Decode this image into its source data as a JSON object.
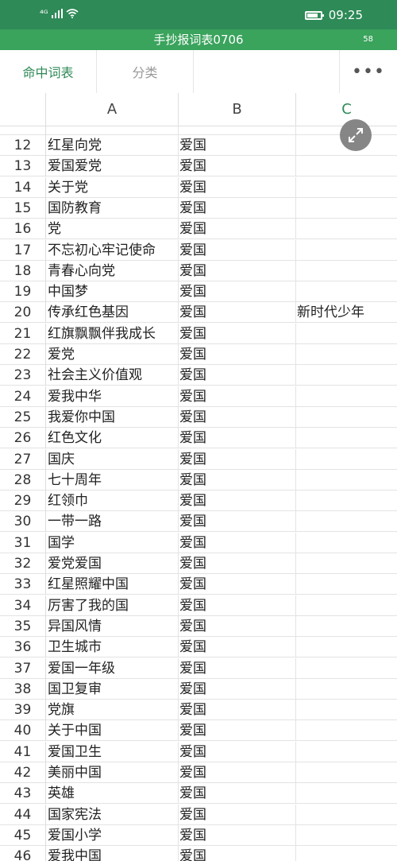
{
  "status": {
    "signal": "⁴ᴳ",
    "time": "09:25"
  },
  "title": {
    "text": "手抄报词表0706",
    "badge": "58"
  },
  "tabs": [
    {
      "label": "命中词表"
    },
    {
      "label": "分类"
    }
  ],
  "more_label": "•••",
  "columns": [
    "A",
    "B",
    "C"
  ],
  "rows": [
    {
      "n": "12",
      "a": "红星向党",
      "b": "爱国",
      "c": ""
    },
    {
      "n": "13",
      "a": "爱国爱党",
      "b": "爱国",
      "c": ""
    },
    {
      "n": "14",
      "a": "关于党",
      "b": "爱国",
      "c": ""
    },
    {
      "n": "15",
      "a": "国防教育",
      "b": "爱国",
      "c": ""
    },
    {
      "n": "16",
      "a": "党",
      "b": "爱国",
      "c": ""
    },
    {
      "n": "17",
      "a": "不忘初心牢记使命",
      "b": "爱国",
      "c": ""
    },
    {
      "n": "18",
      "a": "青春心向党",
      "b": "爱国",
      "c": ""
    },
    {
      "n": "19",
      "a": "中国梦",
      "b": "爱国",
      "c": ""
    },
    {
      "n": "20",
      "a": "传承红色基因",
      "b": "爱国",
      "c": "新时代少年"
    },
    {
      "n": "21",
      "a": "红旗飘飘伴我成长",
      "b": "爱国",
      "c": ""
    },
    {
      "n": "22",
      "a": "爱党",
      "b": "爱国",
      "c": ""
    },
    {
      "n": "23",
      "a": "社会主义价值观",
      "b": "爱国",
      "c": ""
    },
    {
      "n": "24",
      "a": "爱我中华",
      "b": "爱国",
      "c": ""
    },
    {
      "n": "25",
      "a": "我爱你中国",
      "b": "爱国",
      "c": ""
    },
    {
      "n": "26",
      "a": "红色文化",
      "b": "爱国",
      "c": ""
    },
    {
      "n": "27",
      "a": "国庆",
      "b": "爱国",
      "c": ""
    },
    {
      "n": "28",
      "a": "七十周年",
      "b": "爱国",
      "c": ""
    },
    {
      "n": "29",
      "a": "红领巾",
      "b": "爱国",
      "c": ""
    },
    {
      "n": "30",
      "a": "一带一路",
      "b": "爱国",
      "c": ""
    },
    {
      "n": "31",
      "a": "国学",
      "b": "爱国",
      "c": ""
    },
    {
      "n": "32",
      "a": "爱党爱国",
      "b": "爱国",
      "c": ""
    },
    {
      "n": "33",
      "a": "红星照耀中国",
      "b": "爱国",
      "c": ""
    },
    {
      "n": "34",
      "a": "厉害了我的国",
      "b": "爱国",
      "c": ""
    },
    {
      "n": "35",
      "a": "异国风情",
      "b": "爱国",
      "c": ""
    },
    {
      "n": "36",
      "a": "卫生城市",
      "b": "爱国",
      "c": ""
    },
    {
      "n": "37",
      "a": "爱国一年级",
      "b": "爱国",
      "c": ""
    },
    {
      "n": "38",
      "a": "国卫复审",
      "b": "爱国",
      "c": ""
    },
    {
      "n": "39",
      "a": "党旗",
      "b": "爱国",
      "c": ""
    },
    {
      "n": "40",
      "a": "关于中国",
      "b": "爱国",
      "c": ""
    },
    {
      "n": "41",
      "a": "爱国卫生",
      "b": "爱国",
      "c": ""
    },
    {
      "n": "42",
      "a": "美丽中国",
      "b": "爱国",
      "c": ""
    },
    {
      "n": "43",
      "a": "英雄",
      "b": "爱国",
      "c": ""
    },
    {
      "n": "44",
      "a": "国家宪法",
      "b": "爱国",
      "c": ""
    },
    {
      "n": "45",
      "a": "爱国小学",
      "b": "爱国",
      "c": ""
    },
    {
      "n": "46",
      "a": "爱我中国",
      "b": "爱国",
      "c": ""
    }
  ]
}
